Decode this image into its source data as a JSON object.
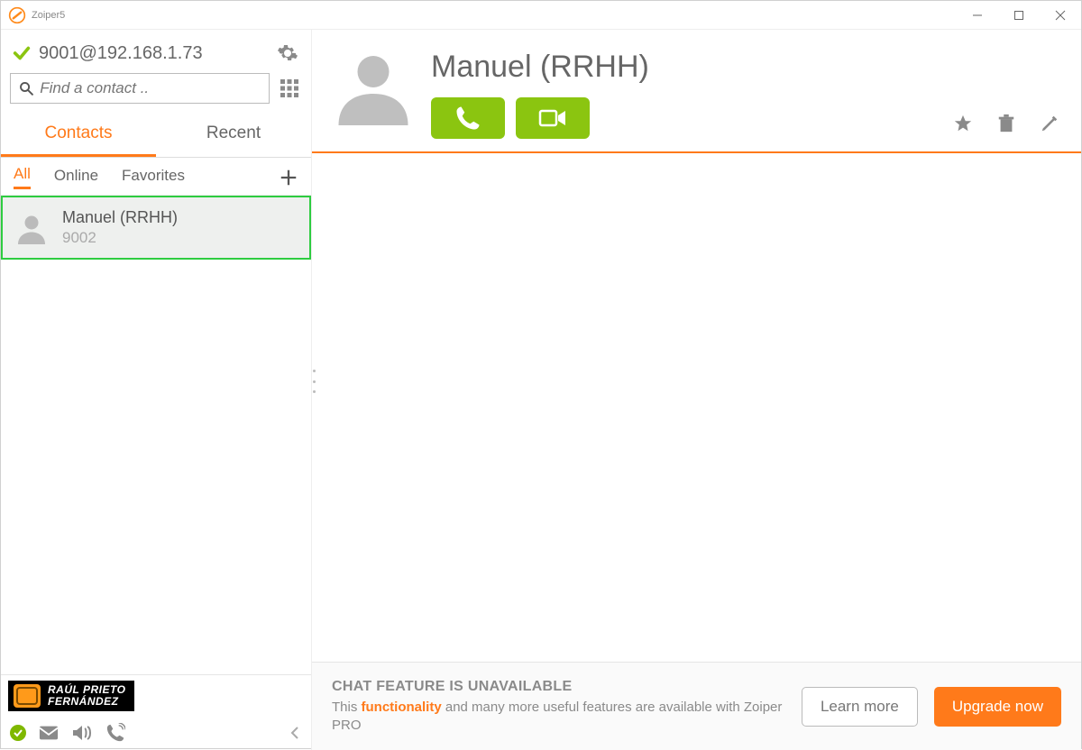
{
  "window": {
    "title": "Zoiper5"
  },
  "account": {
    "id": "9001@192.168.1.73"
  },
  "search": {
    "placeholder": "Find a contact .."
  },
  "primary_tabs": {
    "contacts": "Contacts",
    "recent": "Recent"
  },
  "sub_tabs": {
    "all": "All",
    "online": "Online",
    "favorites": "Favorites"
  },
  "contacts": [
    {
      "name": "Manuel (RRHH)",
      "ext": "9002"
    }
  ],
  "badge": {
    "line1": "RAÚL PRIETO",
    "line2": "FERNÁNDEZ"
  },
  "detail": {
    "name": "Manuel (RRHH)"
  },
  "banner": {
    "title": "CHAT FEATURE IS UNAVAILABLE",
    "sub_pre": "This ",
    "sub_hl": "functionality",
    "sub_post": " and many more useful features are available with Zoiper PRO",
    "learn": "Learn more",
    "upgrade": "Upgrade now"
  }
}
